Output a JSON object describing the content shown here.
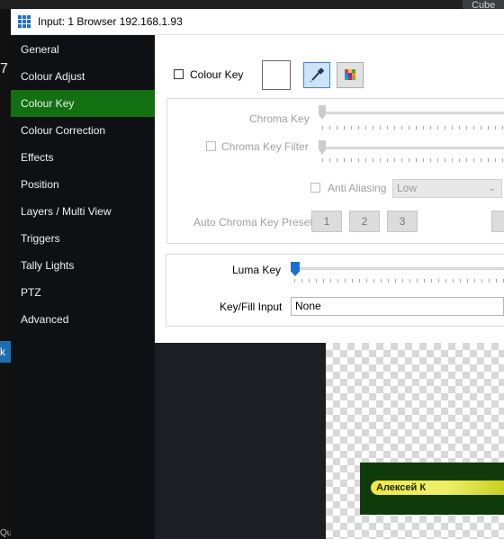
{
  "window": {
    "title": "Input: 1 Browser 192.168.1.93",
    "background_app": {
      "top_right_label": "Cube",
      "left_number": "7",
      "left_blue_label": "k",
      "left_bottom_label": "Qu"
    }
  },
  "sidebar": {
    "active_index": 2,
    "items": [
      {
        "label": "General"
      },
      {
        "label": "Colour Adjust"
      },
      {
        "label": "Colour Key"
      },
      {
        "label": "Colour Correction"
      },
      {
        "label": "Effects"
      },
      {
        "label": "Position"
      },
      {
        "label": "Layers / Multi View"
      },
      {
        "label": "Triggers"
      },
      {
        "label": "Tally Lights"
      },
      {
        "label": "PTZ"
      },
      {
        "label": "Advanced"
      }
    ]
  },
  "colour_key": {
    "checkbox_label": "Colour Key",
    "checked": false,
    "swatch_color": "#ffffff",
    "picker_icon": "eyedropper-icon",
    "palette_icon": "color-palette-icon"
  },
  "chroma": {
    "chroma_key_label": "Chroma Key",
    "chroma_key_filter_label": "Chroma Key Filter",
    "anti_aliasing_label": "Anti Aliasing",
    "anti_aliasing_value": "Low",
    "presets_label": "Auto Chroma Key Presets",
    "preset_buttons": [
      "1",
      "2",
      "3"
    ],
    "chroma_key_level": 0,
    "chroma_key_filter_level": 0
  },
  "luma": {
    "luma_key_label": "Luma Key",
    "luma_key_level": 0,
    "key_fill_label": "Key/Fill Input",
    "key_fill_value": "None"
  },
  "preview": {
    "lower_third_name": "Алексей К"
  },
  "colors": {
    "accent_green": "#127010",
    "sidebar_bg": "#0e1114",
    "slider_thumb": "#1a6fd4"
  }
}
